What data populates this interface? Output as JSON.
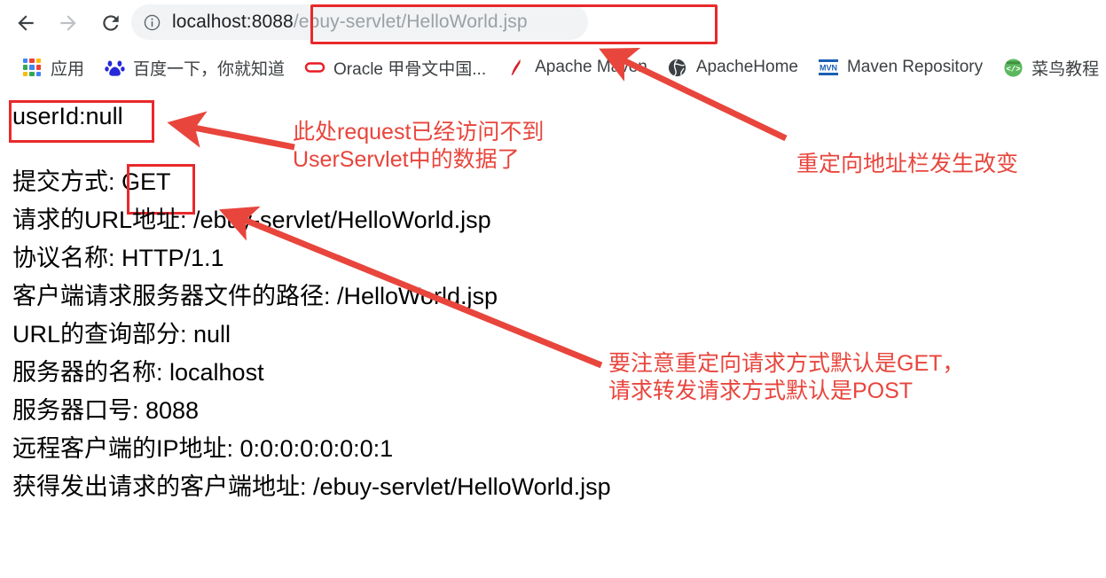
{
  "browser": {
    "nav": {
      "back_icon": "arrow-left-icon",
      "forward_icon": "arrow-right-icon",
      "reload_icon": "reload-icon",
      "info_icon": "info-circle-icon"
    },
    "omnibox": {
      "host": "localhost:8088",
      "path": "/ebuy-servlet/HelloWorld.jsp",
      "full_url": "localhost:8088/ebuy-servlet/HelloWorld.jsp"
    },
    "bookmarks": [
      {
        "label": "应用",
        "icon": "apps-grid-icon"
      },
      {
        "label": "百度一下，你就知道",
        "icon": "baidu-paw-icon"
      },
      {
        "label": "Oracle 甲骨文中国...",
        "icon": "oracle-o-icon"
      },
      {
        "label": "Apache Maven",
        "icon": "apache-feather-icon"
      },
      {
        "label": "ApacheHome",
        "icon": "globe-icon"
      },
      {
        "label": "Maven Repository",
        "icon": "mvn-icon"
      },
      {
        "label": "菜鸟教程",
        "icon": "code-badge-icon"
      }
    ]
  },
  "content": {
    "userid_line": "userId:null",
    "lines": [
      {
        "label": "提交方式:",
        "value": "GET"
      },
      {
        "label": "请求的URL地址:",
        "value": "/ebuy-servlet/HelloWorld.jsp"
      },
      {
        "label": "协议名称:",
        "value": "HTTP/1.1"
      },
      {
        "label": "客户端请求服务器文件的路径:",
        "value": "/HelloWorld.jsp"
      },
      {
        "label": "URL的查询部分:",
        "value": "null"
      },
      {
        "label": "服务器的名称:",
        "value": "localhost"
      },
      {
        "label": "服务器口号:",
        "value": "8088"
      },
      {
        "label": "远程客户端的IP地址:",
        "value": "0:0:0:0:0:0:0:1"
      },
      {
        "label": "获得发出请求的客户端地址:",
        "value": "/ebuy-servlet/HelloWorld.jsp"
      }
    ],
    "line_texts": [
      "提交方式: GET",
      "请求的URL地址: /ebuy-servlet/HelloWorld.jsp",
      "协议名称: HTTP/1.1",
      "客户端请求服务器文件的路径: /HelloWorld.jsp",
      "URL的查询部分: null",
      "服务器的名称: localhost",
      "服务器口号: 8088",
      "远程客户端的IP地址: 0:0:0:0:0:0:0:1",
      "获得发出请求的客户端地址: /ebuy-servlet/HelloWorld.jsp"
    ]
  },
  "annotations": {
    "accent_color": "#e8453c",
    "box_color": "#e8292b",
    "note_request": "此处request已经访问不到\nUserServlet中的数据了",
    "note_redirect": "重定向地址栏发生改变",
    "note_method": "要注意重定向请求方式默认是GET，\n请求转发请求方式默认是POST"
  }
}
